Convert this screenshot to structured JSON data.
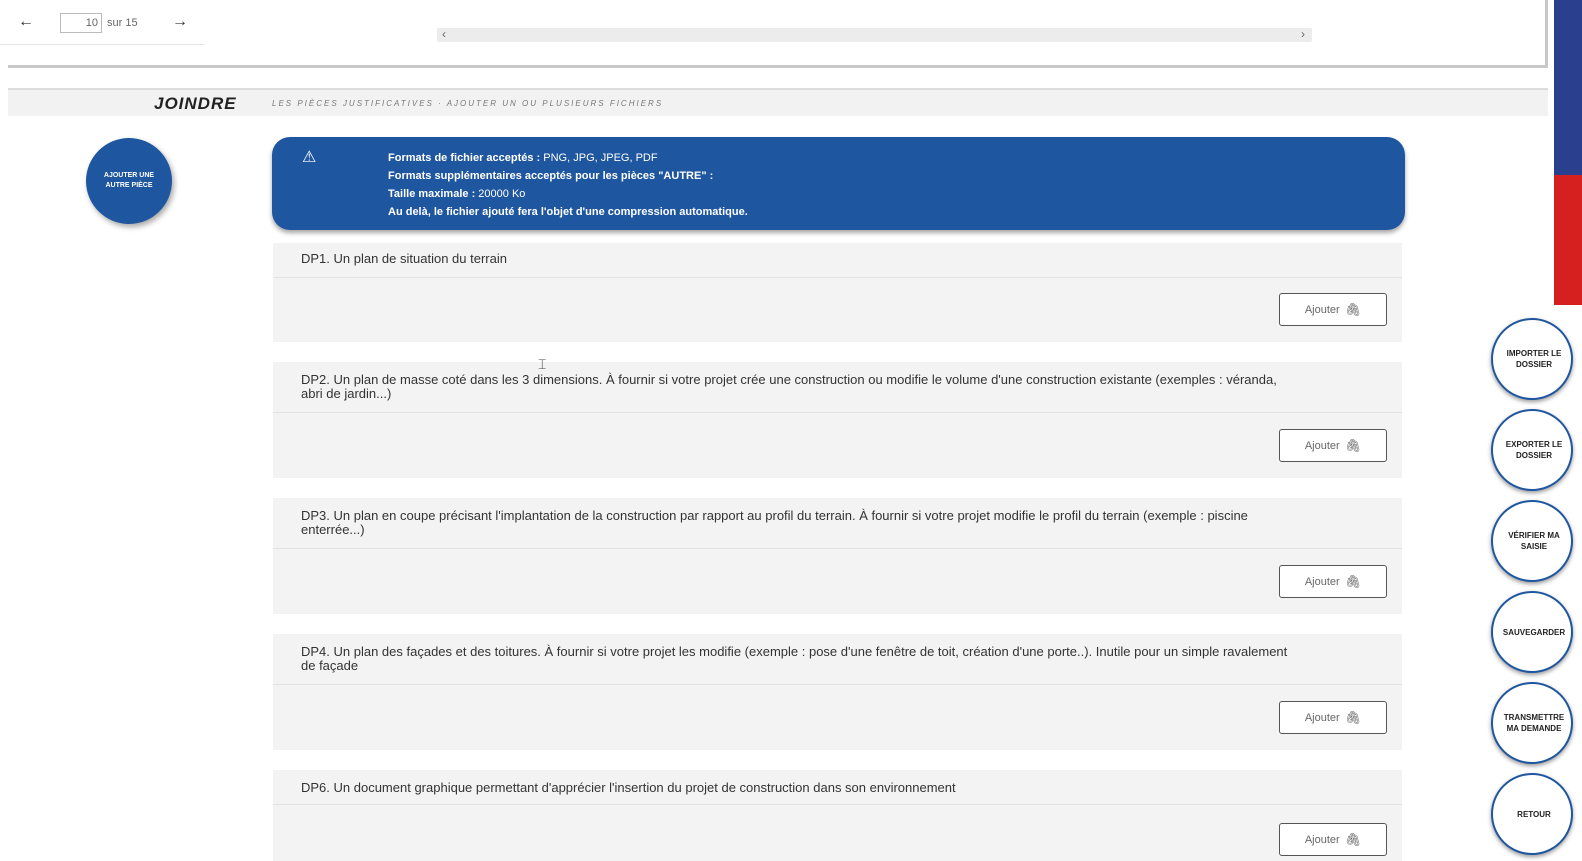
{
  "pager": {
    "prev_icon": "←",
    "next_icon": "→",
    "current_page": "10",
    "total_label": "sur 15"
  },
  "hscroll": {
    "left_icon": "‹",
    "right_icon": "›"
  },
  "section": {
    "title": "JOINDRE",
    "subtitle": "LES PIÈCES JUSTIFICATIVES · AJOUTER UN OU PLUSIEURS FICHIERS"
  },
  "add_piece_button": "AJOUTER UNE AUTRE PIÈCE",
  "info": {
    "warning_icon": "⚠",
    "line1_label": "Formats de fichier acceptés : ",
    "line1_value": "PNG, JPG, JPEG, PDF",
    "line2_label": "Formats supplémentaires acceptés pour les pièces \"AUTRE\" :",
    "line3_label": "Taille maximale : ",
    "line3_value": "20000 Ko",
    "line4_label": "Au delà, le fichier ajouté fera l'objet d'une compression automatique."
  },
  "documents": [
    {
      "title": "DP1. Un plan de situation du terrain",
      "button": "Ajouter"
    },
    {
      "title": "DP2. Un plan de masse coté dans les 3 dimensions. À fournir si votre projet crée une construction ou modifie le volume d'une construction existante (exemples : véranda, abri de jardin...)",
      "button": "Ajouter"
    },
    {
      "title": "DP3. Un plan en coupe précisant l'implantation de la construction par rapport au profil du terrain. À fournir si votre projet modifie le profil du terrain (exemple : piscine enterrée...)",
      "button": "Ajouter"
    },
    {
      "title": "DP4. Un plan des façades et des toitures. À fournir si votre projet les modifie (exemple : pose d'une fenêtre de toit, création d'une porte..). Inutile pour un simple ravalement de façade",
      "button": "Ajouter"
    },
    {
      "title": "DP6. Un document graphique permettant d'apprécier l'insertion du projet de construction dans son environnement",
      "button": "Ajouter"
    }
  ],
  "clip_icon": "🖇",
  "side_actions": [
    "IMPORTER LE DOSSIER",
    "EXPORTER LE DOSSIER",
    "VÉRIFIER MA SAISIE",
    "SAUVEGARDER",
    "TRANSMETTRE MA DEMANDE",
    "RETOUR"
  ],
  "colors": {
    "primary": "#1f56a0",
    "flag_blue": "#2b3f8f",
    "flag_red": "#d62020"
  }
}
